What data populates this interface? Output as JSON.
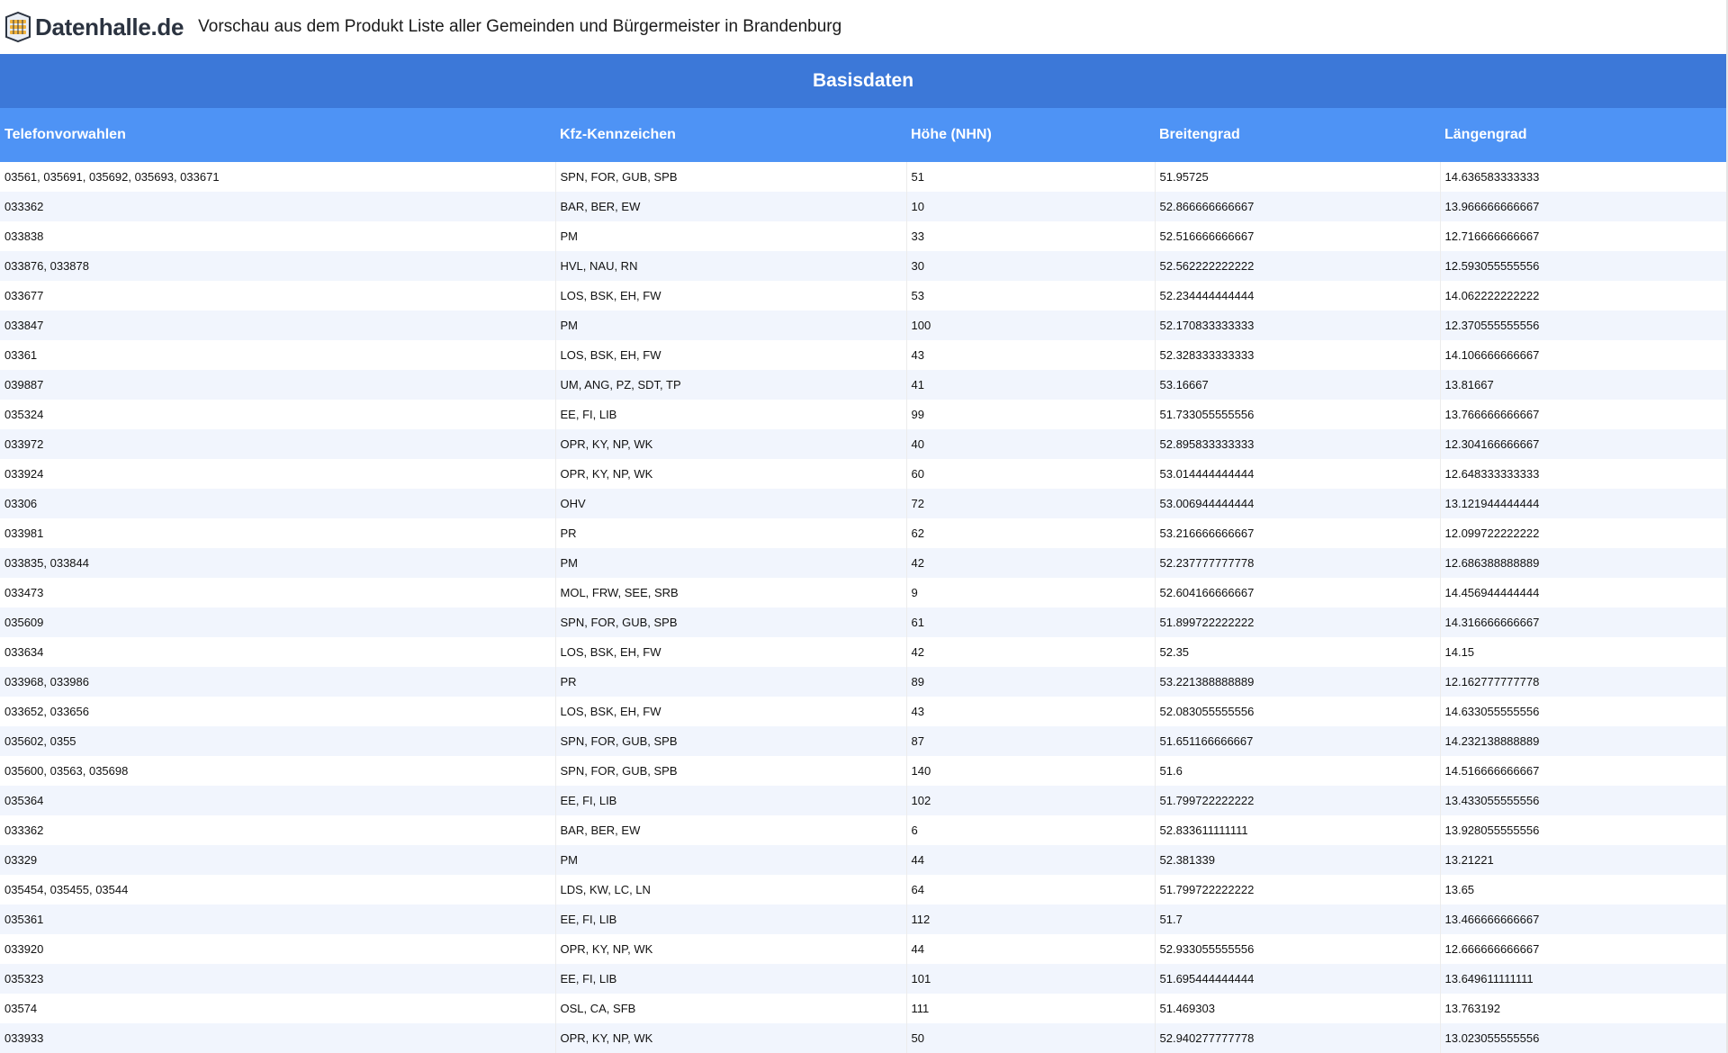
{
  "header": {
    "logo_text": "Datenhalle.de",
    "title": "Vorschau aus dem Produkt Liste aller Gemeinden und Bürgermeister in Brandenburg"
  },
  "table": {
    "group_title": "Basisdaten",
    "columns": [
      "Telefonvorwahlen",
      "Kfz-Kennzeichen",
      "Höhe (NHN)",
      "Breitengrad",
      "Längengrad"
    ],
    "rows": [
      [
        "03561, 035691, 035692, 035693, 033671",
        "SPN, FOR, GUB, SPB",
        "51",
        "51.95725",
        "14.636583333333"
      ],
      [
        "033362",
        "BAR, BER, EW",
        "10",
        "52.866666666667",
        "13.966666666667"
      ],
      [
        "033838",
        "PM",
        "33",
        "52.516666666667",
        "12.716666666667"
      ],
      [
        "033876, 033878",
        "HVL, NAU, RN",
        "30",
        "52.562222222222",
        "12.593055555556"
      ],
      [
        "033677",
        "LOS, BSK, EH, FW",
        "53",
        "52.234444444444",
        "14.062222222222"
      ],
      [
        "033847",
        "PM",
        "100",
        "52.170833333333",
        "12.370555555556"
      ],
      [
        "03361",
        "LOS, BSK, EH, FW",
        "43",
        "52.328333333333",
        "14.106666666667"
      ],
      [
        "039887",
        "UM, ANG, PZ, SDT, TP",
        "41",
        "53.16667",
        "13.81667"
      ],
      [
        "035324",
        "EE, FI, LIB",
        "99",
        "51.733055555556",
        "13.766666666667"
      ],
      [
        "033972",
        "OPR, KY, NP, WK",
        "40",
        "52.895833333333",
        "12.304166666667"
      ],
      [
        "033924",
        "OPR, KY, NP, WK",
        "60",
        "53.014444444444",
        "12.648333333333"
      ],
      [
        "03306",
        "OHV",
        "72",
        "53.006944444444",
        "13.121944444444"
      ],
      [
        "033981",
        "PR",
        "62",
        "53.216666666667",
        "12.099722222222"
      ],
      [
        "033835, 033844",
        "PM",
        "42",
        "52.237777777778",
        "12.686388888889"
      ],
      [
        "033473",
        "MOL, FRW, SEE, SRB",
        "9",
        "52.604166666667",
        "14.456944444444"
      ],
      [
        "035609",
        "SPN, FOR, GUB, SPB",
        "61",
        "51.899722222222",
        "14.316666666667"
      ],
      [
        "033634",
        "LOS, BSK, EH, FW",
        "42",
        "52.35",
        "14.15"
      ],
      [
        "033968, 033986",
        "PR",
        "89",
        "53.221388888889",
        "12.162777777778"
      ],
      [
        "033652, 033656",
        "LOS, BSK, EH, FW",
        "43",
        "52.083055555556",
        "14.633055555556"
      ],
      [
        "035602, 0355",
        "SPN, FOR, GUB, SPB",
        "87",
        "51.651166666667",
        "14.232138888889"
      ],
      [
        "035600, 03563, 035698",
        "SPN, FOR, GUB, SPB",
        "140",
        "51.6",
        "14.516666666667"
      ],
      [
        "035364",
        "EE, FI, LIB",
        "102",
        "51.799722222222",
        "13.433055555556"
      ],
      [
        "033362",
        "BAR, BER, EW",
        "6",
        "52.833611111111",
        "13.928055555556"
      ],
      [
        "03329",
        "PM",
        "44",
        "52.381339",
        "13.21221"
      ],
      [
        "035454, 035455, 03544",
        "LDS, KW, LC, LN",
        "64",
        "51.799722222222",
        "13.65"
      ],
      [
        "035361",
        "EE, FI, LIB",
        "112",
        "51.7",
        "13.466666666667"
      ],
      [
        "033920",
        "OPR, KY, NP, WK",
        "44",
        "52.933055555556",
        "12.666666666667"
      ],
      [
        "035323",
        "EE, FI, LIB",
        "101",
        "51.695444444444",
        "13.649611111111"
      ],
      [
        "03574",
        "OSL, CA, SFB",
        "111",
        "51.469303",
        "13.763192"
      ],
      [
        "033933",
        "OPR, KY, NP, WK",
        "50",
        "52.940277777778",
        "13.023055555556"
      ]
    ]
  }
}
